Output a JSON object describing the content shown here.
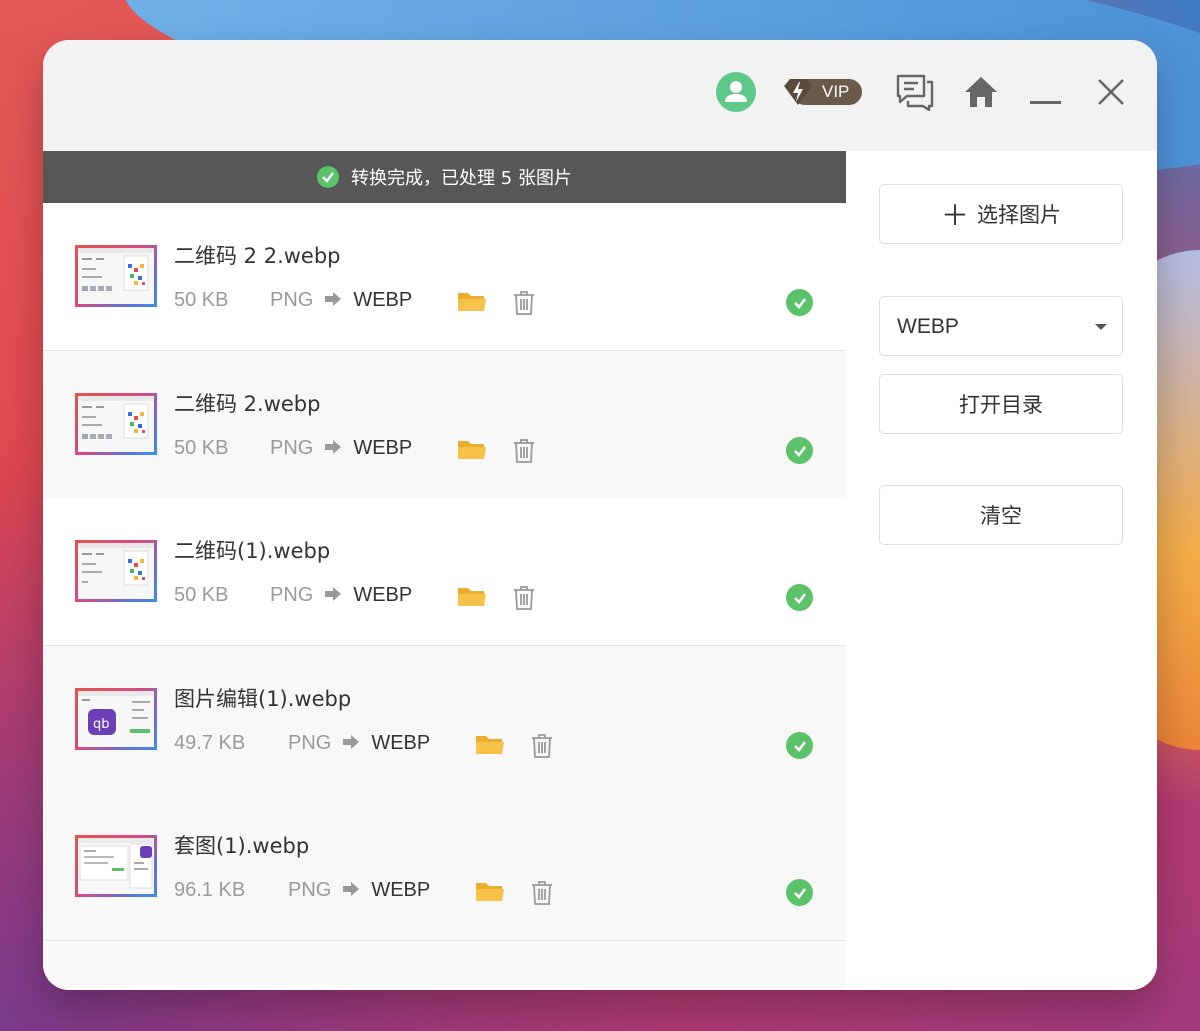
{
  "titlebar": {
    "vip_label": "VIP",
    "icons": [
      "user-avatar-icon",
      "vip-badge-icon",
      "feedback-icon",
      "home-icon",
      "minimize-icon",
      "close-icon"
    ]
  },
  "status": {
    "message": "转换完成，已处理 5 张图片"
  },
  "files": [
    {
      "name": "二维码 2 2.webp",
      "size": "50 KB",
      "from": "PNG",
      "to": "WEBP"
    },
    {
      "name": "二维码 2.webp",
      "size": "50 KB",
      "from": "PNG",
      "to": "WEBP"
    },
    {
      "name": "二维码(1).webp",
      "size": "50 KB",
      "from": "PNG",
      "to": "WEBP"
    },
    {
      "name": "图片编辑(1).webp",
      "size": "49.7 KB",
      "from": "PNG",
      "to": "WEBP"
    },
    {
      "name": "套图(1).webp",
      "size": "96.1 KB",
      "from": "PNG",
      "to": "WEBP"
    }
  ],
  "sidebar": {
    "select_button": "选择图片",
    "select_button_icon": "＋",
    "format_value": "WEBP",
    "open_dir_button": "打开目录",
    "clear_button": "清空"
  },
  "colors": {
    "success": "#5cc26a",
    "avatar": "#5cc98a",
    "banner_bg": "#575757",
    "folder": "#f6c24a"
  }
}
